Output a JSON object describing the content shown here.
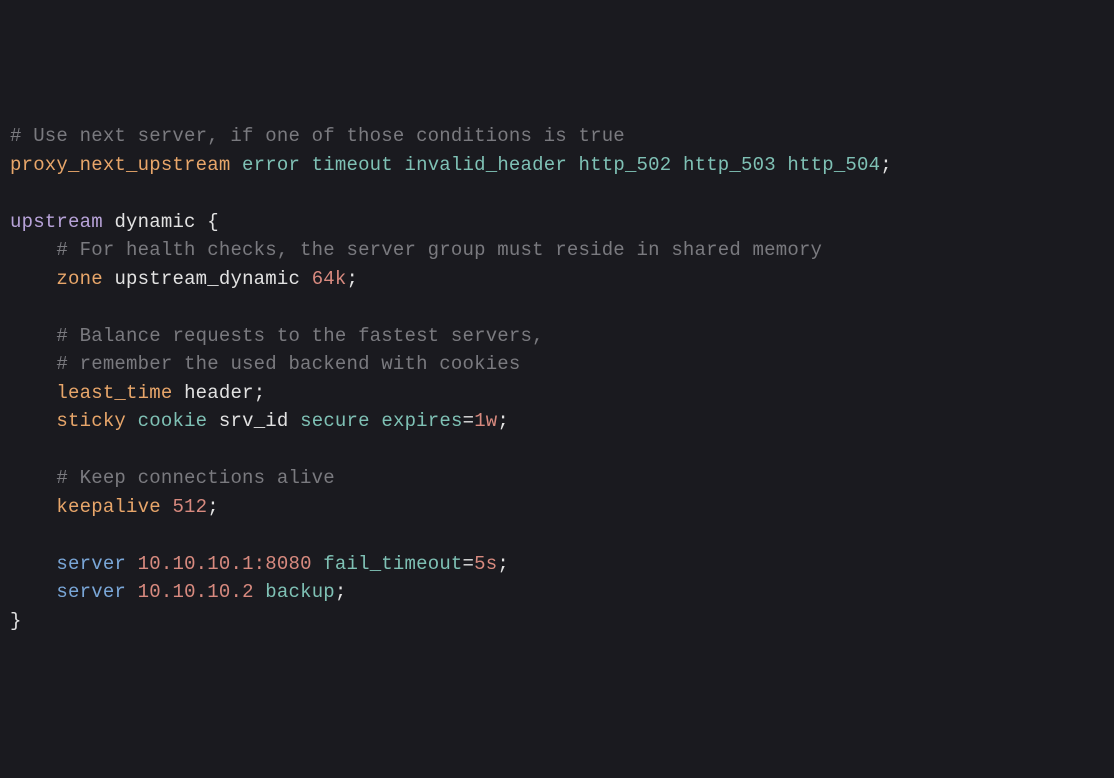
{
  "lines": {
    "l1_comment": "# Use next server, if one of those conditions is true",
    "l2_directive": "proxy_next_upstream",
    "l2_v1": "error",
    "l2_v2": "timeout",
    "l2_v3": "invalid_header",
    "l2_v4": "http_502",
    "l2_v5": "http_503",
    "l2_v6": "http_504",
    "l4_keyword": "upstream",
    "l4_name": "dynamic",
    "l4_brace": "{",
    "l5_comment": "# For health checks, the server group must reside in shared memory",
    "l6_directive": "zone",
    "l6_name": "upstream_dynamic",
    "l6_size": "64k",
    "l8_comment": "# Balance requests to the fastest servers,",
    "l9_comment": "# remember the used backend with cookies",
    "l10_directive": "least_time",
    "l10_value": "header",
    "l11_directive": "sticky",
    "l11_v1": "cookie",
    "l11_v2": "srv_id",
    "l11_v3": "secure",
    "l11_key": "expires",
    "l11_eq": "=",
    "l11_val": "1w",
    "l13_comment": "# Keep connections alive",
    "l14_directive": "keepalive",
    "l14_value": "512",
    "l16_directive": "server",
    "l16_addr": "10.10.10.1:8080",
    "l16_key": "fail_timeout",
    "l16_eq": "=",
    "l16_val": "5s",
    "l17_directive": "server",
    "l17_addr": "10.10.10.2",
    "l17_backup": "backup",
    "l18_brace": "}",
    "semicolon": ";"
  }
}
